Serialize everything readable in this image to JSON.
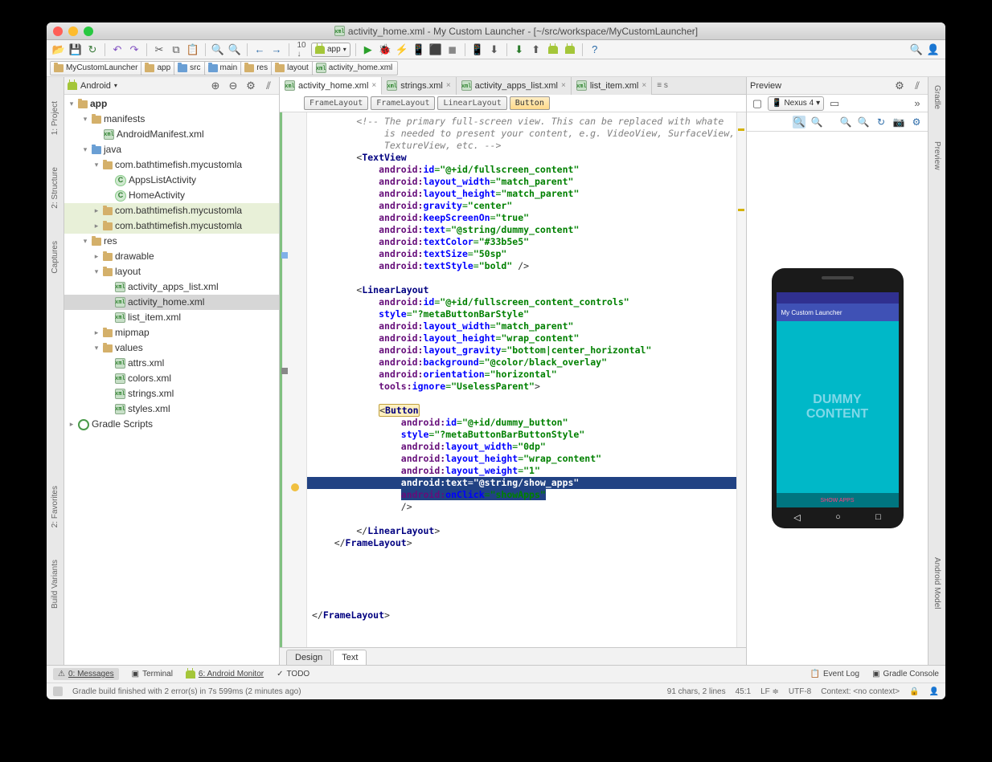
{
  "title": "activity_home.xml - My Custom Launcher - [~/src/workspace/MyCustomLauncher]",
  "breadcrumbs": [
    "MyCustomLauncher",
    "app",
    "src",
    "main",
    "res",
    "layout",
    "activity_home.xml"
  ],
  "project_dropdown": "Android",
  "app_dropdown": "app",
  "tree": {
    "app": "app",
    "manifests": "manifests",
    "manifest_file": "AndroidManifest.xml",
    "java": "java",
    "pkg1": "com.bathtimefish.mycustomla",
    "cls1": "AppsListActivity",
    "cls2": "HomeActivity",
    "pkg2": "com.bathtimefish.mycustomla",
    "pkg3": "com.bathtimefish.mycustomla",
    "res": "res",
    "drawable": "drawable",
    "layout": "layout",
    "lay1": "activity_apps_list.xml",
    "lay2": "activity_home.xml",
    "lay3": "list_item.xml",
    "mipmap": "mipmap",
    "values": "values",
    "v1": "attrs.xml",
    "v2": "colors.xml",
    "v3": "strings.xml",
    "v4": "styles.xml",
    "gradle": "Gradle Scripts"
  },
  "tabs": [
    {
      "name": "activity_home.xml",
      "active": true
    },
    {
      "name": "strings.xml"
    },
    {
      "name": "activity_apps_list.xml"
    },
    {
      "name": "list_item.xml"
    }
  ],
  "extra_tab": "≡ s",
  "crumb_pills": [
    "FrameLayout",
    "FrameLayout",
    "LinearLayout",
    "Button"
  ],
  "code": {
    "comment1": "<!-- The primary full-screen view. This can be replaced with whate",
    "comment2": "     is needed to present your content, e.g. VideoView, SurfaceView,",
    "comment3": "     TextureView, etc. -->",
    "tv_id": "\"@+id/fullscreen_content\"",
    "tv_w": "\"match_parent\"",
    "tv_h": "\"match_parent\"",
    "tv_grav": "\"center\"",
    "tv_keep": "\"true\"",
    "tv_text": "\"@string/dummy_content\"",
    "tv_color": "\"#33b5e5\"",
    "tv_size": "\"50sp\"",
    "tv_style": "\"bold\"",
    "ll_id": "\"@+id/fullscreen_content_controls\"",
    "ll_style": "\"?metaButtonBarStyle\"",
    "ll_w": "\"match_parent\"",
    "ll_h": "\"wrap_content\"",
    "ll_grav": "\"bottom|center_horizontal\"",
    "ll_bg": "\"@color/black_overlay\"",
    "ll_orient": "\"horizontal\"",
    "ll_ignore": "\"UselessParent\"",
    "btn_id": "\"@+id/dummy_button\"",
    "btn_style": "\"?metaButtonBarButtonStyle\"",
    "btn_w": "\"0dp\"",
    "btn_h": "\"wrap_content\"",
    "btn_weight": "\"1\"",
    "btn_text": "\"@string/show_apps\"",
    "btn_click": "\"showApps\""
  },
  "design_tabs": {
    "design": "Design",
    "text": "Text"
  },
  "preview": {
    "title": "Preview",
    "device": "Nexus 4",
    "app_bar": "My Custom Launcher",
    "dummy1": "DUMMY",
    "dummy2": "CONTENT",
    "show_apps": "SHOW APPS"
  },
  "bottom": {
    "messages": "0: Messages",
    "terminal": "Terminal",
    "monitor": "6: Android Monitor",
    "todo": "TODO",
    "eventlog": "Event Log",
    "console": "Gradle Console"
  },
  "status": {
    "build": "Gradle build finished with 2 error(s) in 7s 599ms (2 minutes ago)",
    "chars": "91 chars, 2 lines",
    "pos": "45:1",
    "le": "LF",
    "enc": "UTF-8",
    "ctx": "Context: <no context>"
  },
  "side_right": {
    "gradle": "Gradle",
    "preview": "Preview",
    "model": "Android Model"
  },
  "side_left": {
    "project": "1: Project",
    "structure": "2: Structure",
    "captures": "Captures",
    "bv": "Build Variants",
    "fav": "2: Favorites"
  }
}
